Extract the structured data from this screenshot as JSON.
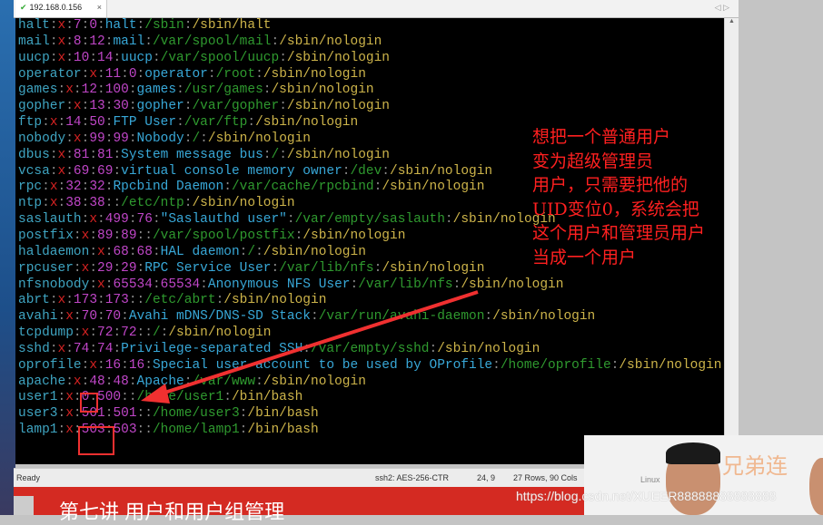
{
  "tab": {
    "title": "192.168.0.156",
    "close": "×",
    "status_icon": "check-icon"
  },
  "terminal": {
    "lines": [
      [
        "halt",
        "7",
        "0",
        "halt",
        "/sbin",
        "/sbin/halt"
      ],
      [
        "mail",
        "8",
        "12",
        "mail",
        "/var/spool/mail",
        "/sbin/nologin"
      ],
      [
        "uucp",
        "10",
        "14",
        "uucp",
        "/var/spool/uucp",
        "/sbin/nologin"
      ],
      [
        "operator",
        "11",
        "0",
        "operator",
        "/root",
        "/sbin/nologin"
      ],
      [
        "games",
        "12",
        "100",
        "games",
        "/usr/games",
        "/sbin/nologin"
      ],
      [
        "gopher",
        "13",
        "30",
        "gopher",
        "/var/gopher",
        "/sbin/nologin"
      ],
      [
        "ftp",
        "14",
        "50",
        "FTP User",
        "/var/ftp",
        "/sbin/nologin"
      ],
      [
        "nobody",
        "99",
        "99",
        "Nobody",
        "/",
        "/sbin/nologin"
      ],
      [
        "dbus",
        "81",
        "81",
        "System message bus",
        "/",
        "/sbin/nologin"
      ],
      [
        "vcsa",
        "69",
        "69",
        "virtual console memory owner",
        "/dev",
        "/sbin/nologin"
      ],
      [
        "rpc",
        "32",
        "32",
        "Rpcbind Daemon",
        "/var/cache/rpcbind",
        "/sbin/nologin"
      ],
      [
        "ntp",
        "38",
        "38",
        "",
        "/etc/ntp",
        "/sbin/nologin"
      ],
      [
        "saslauth",
        "499",
        "76",
        "\"Saslauthd user\"",
        "/var/empty/saslauth",
        "/sbin/nologin"
      ],
      [
        "postfix",
        "89",
        "89",
        "",
        "/var/spool/postfix",
        "/sbin/nologin"
      ],
      [
        "haldaemon",
        "68",
        "68",
        "HAL daemon",
        "/",
        "/sbin/nologin"
      ],
      [
        "rpcuser",
        "29",
        "29",
        "RPC Service User",
        "/var/lib/nfs",
        "/sbin/nologin"
      ],
      [
        "nfsnobody",
        "65534",
        "65534",
        "Anonymous NFS User",
        "/var/lib/nfs",
        "/sbin/nologin"
      ],
      [
        "abrt",
        "173",
        "173",
        "",
        "/etc/abrt",
        "/sbin/nologin"
      ],
      [
        "avahi",
        "70",
        "70",
        "Avahi mDNS/DNS-SD Stack",
        "/var/run/avahi-daemon",
        "/sbin/nologin"
      ],
      [
        "tcpdump",
        "72",
        "72",
        "",
        "/",
        "/sbin/nologin"
      ],
      [
        "sshd",
        "74",
        "74",
        "Privilege-separated SSH",
        "/var/empty/sshd",
        "/sbin/nologin"
      ],
      [
        "oprofile",
        "16",
        "16",
        "Special user account to be used by OProfile",
        "/home/oprofile",
        "/sbin/nologin"
      ],
      [
        "apache",
        "48",
        "48",
        "Apache",
        "/var/www",
        "/sbin/nologin"
      ],
      [
        "user1",
        "0",
        "500",
        "",
        "/home/user1",
        "/bin/bash"
      ],
      [
        "user3",
        "501",
        "501",
        "",
        "/home/user3",
        "/bin/bash"
      ],
      [
        "lamp1",
        "503",
        "503",
        "",
        "/home/lamp1",
        "/bin/bash"
      ]
    ]
  },
  "annotation": "想把一个普通用户\n变为超级管理员\n用户，只需要把他的\nUID变位0，系统会把\n这个用户和管理员用户\n当成一个用户",
  "statusbar": {
    "ready": "Ready",
    "cipher": "ssh2: AES-256-CTR",
    "cursor": "24,  9",
    "size": "27 Rows, 90 Cols"
  },
  "banner": {
    "title": "第七讲 用户和用户组管理"
  },
  "video": {
    "brand": "兄弟连",
    "linux": "Linux"
  },
  "watermark": "https://blog.csdn.net/XUEER88888888888888",
  "colors": {
    "annotation": "#ff2020",
    "banner": "#d42a22",
    "terminal_bg": "#000000"
  }
}
